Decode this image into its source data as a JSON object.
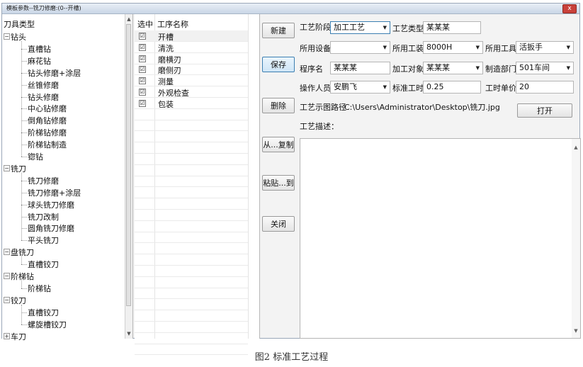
{
  "window": {
    "title": "模板参数--铣刀修磨:(0--开槽)",
    "close_label": "x"
  },
  "tree": {
    "header": "刀具类型",
    "nodes": [
      {
        "label": "钻头",
        "level": 0,
        "expander": "−"
      },
      {
        "label": "直槽钻",
        "level": 1
      },
      {
        "label": "麻花钻",
        "level": 1
      },
      {
        "label": "钻头修磨+涂层",
        "level": 1
      },
      {
        "label": "丝锥修磨",
        "level": 1
      },
      {
        "label": "钻头修磨",
        "level": 1
      },
      {
        "label": "中心钻修磨",
        "level": 1
      },
      {
        "label": "倒角钻修磨",
        "level": 1
      },
      {
        "label": "阶梯钻修磨",
        "level": 1
      },
      {
        "label": "阶梯钻制造",
        "level": 1
      },
      {
        "label": "锪钻",
        "level": 1
      },
      {
        "label": "铣刀",
        "level": 0,
        "expander": "−"
      },
      {
        "label": "铣刀修磨",
        "level": 1
      },
      {
        "label": "铣刀修磨+涂层",
        "level": 1
      },
      {
        "label": "球头铣刀修磨",
        "level": 1
      },
      {
        "label": "铣刀改制",
        "level": 1
      },
      {
        "label": "圆角铣刀修磨",
        "level": 1
      },
      {
        "label": "平头铣刀",
        "level": 1
      },
      {
        "label": "盘铣刀",
        "level": 0,
        "expander": "−"
      },
      {
        "label": "直槽铰刀",
        "level": 1
      },
      {
        "label": "阶梯钻",
        "level": 0,
        "expander": "−"
      },
      {
        "label": "阶梯钻",
        "level": 1
      },
      {
        "label": "铰刀",
        "level": 0,
        "expander": "−"
      },
      {
        "label": "直槽铰刀",
        "level": 1
      },
      {
        "label": "螺旋槽铰刀",
        "level": 1
      },
      {
        "label": "车刀",
        "level": 0,
        "expander": "+"
      }
    ]
  },
  "process_list": {
    "col_select": "选中",
    "col_name": "工序名称",
    "rows": [
      {
        "checked": "☑",
        "name": "开槽"
      },
      {
        "checked": "☑",
        "name": "清洗"
      },
      {
        "checked": "☑",
        "name": "磨横刃"
      },
      {
        "checked": "☑",
        "name": "磨侧刃"
      },
      {
        "checked": "☑",
        "name": "测量"
      },
      {
        "checked": "☑",
        "name": "外观检查"
      },
      {
        "checked": "☑",
        "name": "包装"
      }
    ]
  },
  "buttons": {
    "new": "新建",
    "save": "保存",
    "delete": "删除",
    "copy_from": "从...复制",
    "paste_to": "粘贴...到",
    "close": "关闭",
    "open": "打开"
  },
  "form": {
    "stage_label": "工艺阶段",
    "stage_value": "加工工艺",
    "type_label": "工艺类型",
    "type_value": "某某某",
    "equipment_label": "所用设备",
    "equipment_value": "",
    "fixture_label": "所用工装",
    "fixture_value": "8000H",
    "tool_label": "所用工具",
    "tool_value": "活扳手",
    "name_label": "程序名",
    "name_value": "某某某",
    "object_label": "加工对象",
    "object_value": "某某某",
    "dept_label": "制造部门",
    "dept_value": "501车间",
    "operator_label": "操作人员",
    "operator_value": "安鹏飞",
    "std_hours_label": "标准工时",
    "std_hours_value": "0.25",
    "unit_price_label": "工时单价",
    "unit_price_value": "20",
    "image_path_label": "工艺示图路径",
    "image_path_value": "C:\\Users\\Administrator\\Desktop\\铣刀.jpg",
    "desc_label": "工艺描述："
  },
  "caption": "图2 标准工艺过程"
}
